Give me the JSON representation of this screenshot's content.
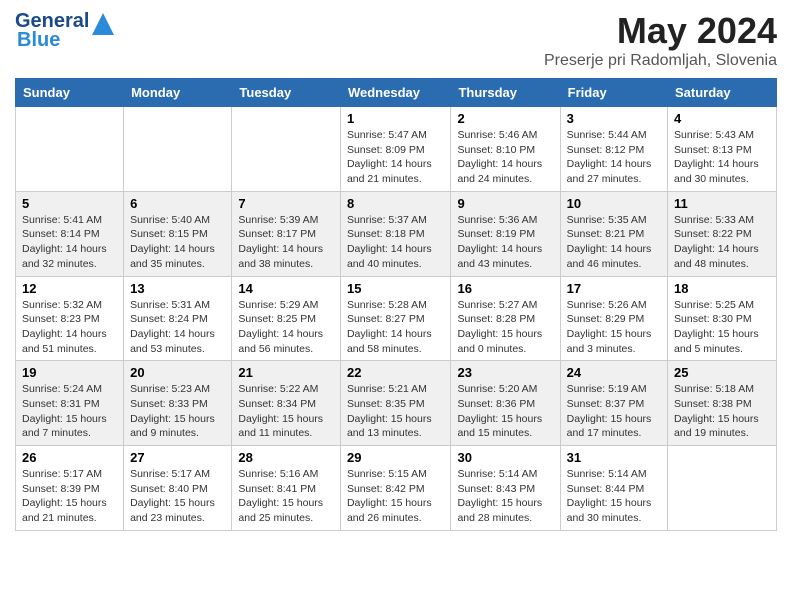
{
  "header": {
    "logo_general": "General",
    "logo_blue": "Blue",
    "title": "May 2024",
    "subtitle": "Preserje pri Radomljah, Slovenia"
  },
  "days_of_week": [
    "Sunday",
    "Monday",
    "Tuesday",
    "Wednesday",
    "Thursday",
    "Friday",
    "Saturday"
  ],
  "weeks": [
    {
      "row_class": "row-odd",
      "days": [
        {
          "number": "",
          "info": ""
        },
        {
          "number": "",
          "info": ""
        },
        {
          "number": "",
          "info": ""
        },
        {
          "number": "1",
          "info": "Sunrise: 5:47 AM\nSunset: 8:09 PM\nDaylight: 14 hours\nand 21 minutes."
        },
        {
          "number": "2",
          "info": "Sunrise: 5:46 AM\nSunset: 8:10 PM\nDaylight: 14 hours\nand 24 minutes."
        },
        {
          "number": "3",
          "info": "Sunrise: 5:44 AM\nSunset: 8:12 PM\nDaylight: 14 hours\nand 27 minutes."
        },
        {
          "number": "4",
          "info": "Sunrise: 5:43 AM\nSunset: 8:13 PM\nDaylight: 14 hours\nand 30 minutes."
        }
      ]
    },
    {
      "row_class": "row-even",
      "days": [
        {
          "number": "5",
          "info": "Sunrise: 5:41 AM\nSunset: 8:14 PM\nDaylight: 14 hours\nand 32 minutes."
        },
        {
          "number": "6",
          "info": "Sunrise: 5:40 AM\nSunset: 8:15 PM\nDaylight: 14 hours\nand 35 minutes."
        },
        {
          "number": "7",
          "info": "Sunrise: 5:39 AM\nSunset: 8:17 PM\nDaylight: 14 hours\nand 38 minutes."
        },
        {
          "number": "8",
          "info": "Sunrise: 5:37 AM\nSunset: 8:18 PM\nDaylight: 14 hours\nand 40 minutes."
        },
        {
          "number": "9",
          "info": "Sunrise: 5:36 AM\nSunset: 8:19 PM\nDaylight: 14 hours\nand 43 minutes."
        },
        {
          "number": "10",
          "info": "Sunrise: 5:35 AM\nSunset: 8:21 PM\nDaylight: 14 hours\nand 46 minutes."
        },
        {
          "number": "11",
          "info": "Sunrise: 5:33 AM\nSunset: 8:22 PM\nDaylight: 14 hours\nand 48 minutes."
        }
      ]
    },
    {
      "row_class": "row-odd",
      "days": [
        {
          "number": "12",
          "info": "Sunrise: 5:32 AM\nSunset: 8:23 PM\nDaylight: 14 hours\nand 51 minutes."
        },
        {
          "number": "13",
          "info": "Sunrise: 5:31 AM\nSunset: 8:24 PM\nDaylight: 14 hours\nand 53 minutes."
        },
        {
          "number": "14",
          "info": "Sunrise: 5:29 AM\nSunset: 8:25 PM\nDaylight: 14 hours\nand 56 minutes."
        },
        {
          "number": "15",
          "info": "Sunrise: 5:28 AM\nSunset: 8:27 PM\nDaylight: 14 hours\nand 58 minutes."
        },
        {
          "number": "16",
          "info": "Sunrise: 5:27 AM\nSunset: 8:28 PM\nDaylight: 15 hours\nand 0 minutes."
        },
        {
          "number": "17",
          "info": "Sunrise: 5:26 AM\nSunset: 8:29 PM\nDaylight: 15 hours\nand 3 minutes."
        },
        {
          "number": "18",
          "info": "Sunrise: 5:25 AM\nSunset: 8:30 PM\nDaylight: 15 hours\nand 5 minutes."
        }
      ]
    },
    {
      "row_class": "row-even",
      "days": [
        {
          "number": "19",
          "info": "Sunrise: 5:24 AM\nSunset: 8:31 PM\nDaylight: 15 hours\nand 7 minutes."
        },
        {
          "number": "20",
          "info": "Sunrise: 5:23 AM\nSunset: 8:33 PM\nDaylight: 15 hours\nand 9 minutes."
        },
        {
          "number": "21",
          "info": "Sunrise: 5:22 AM\nSunset: 8:34 PM\nDaylight: 15 hours\nand 11 minutes."
        },
        {
          "number": "22",
          "info": "Sunrise: 5:21 AM\nSunset: 8:35 PM\nDaylight: 15 hours\nand 13 minutes."
        },
        {
          "number": "23",
          "info": "Sunrise: 5:20 AM\nSunset: 8:36 PM\nDaylight: 15 hours\nand 15 minutes."
        },
        {
          "number": "24",
          "info": "Sunrise: 5:19 AM\nSunset: 8:37 PM\nDaylight: 15 hours\nand 17 minutes."
        },
        {
          "number": "25",
          "info": "Sunrise: 5:18 AM\nSunset: 8:38 PM\nDaylight: 15 hours\nand 19 minutes."
        }
      ]
    },
    {
      "row_class": "row-odd",
      "days": [
        {
          "number": "26",
          "info": "Sunrise: 5:17 AM\nSunset: 8:39 PM\nDaylight: 15 hours\nand 21 minutes."
        },
        {
          "number": "27",
          "info": "Sunrise: 5:17 AM\nSunset: 8:40 PM\nDaylight: 15 hours\nand 23 minutes."
        },
        {
          "number": "28",
          "info": "Sunrise: 5:16 AM\nSunset: 8:41 PM\nDaylight: 15 hours\nand 25 minutes."
        },
        {
          "number": "29",
          "info": "Sunrise: 5:15 AM\nSunset: 8:42 PM\nDaylight: 15 hours\nand 26 minutes."
        },
        {
          "number": "30",
          "info": "Sunrise: 5:14 AM\nSunset: 8:43 PM\nDaylight: 15 hours\nand 28 minutes."
        },
        {
          "number": "31",
          "info": "Sunrise: 5:14 AM\nSunset: 8:44 PM\nDaylight: 15 hours\nand 30 minutes."
        },
        {
          "number": "",
          "info": ""
        }
      ]
    }
  ]
}
